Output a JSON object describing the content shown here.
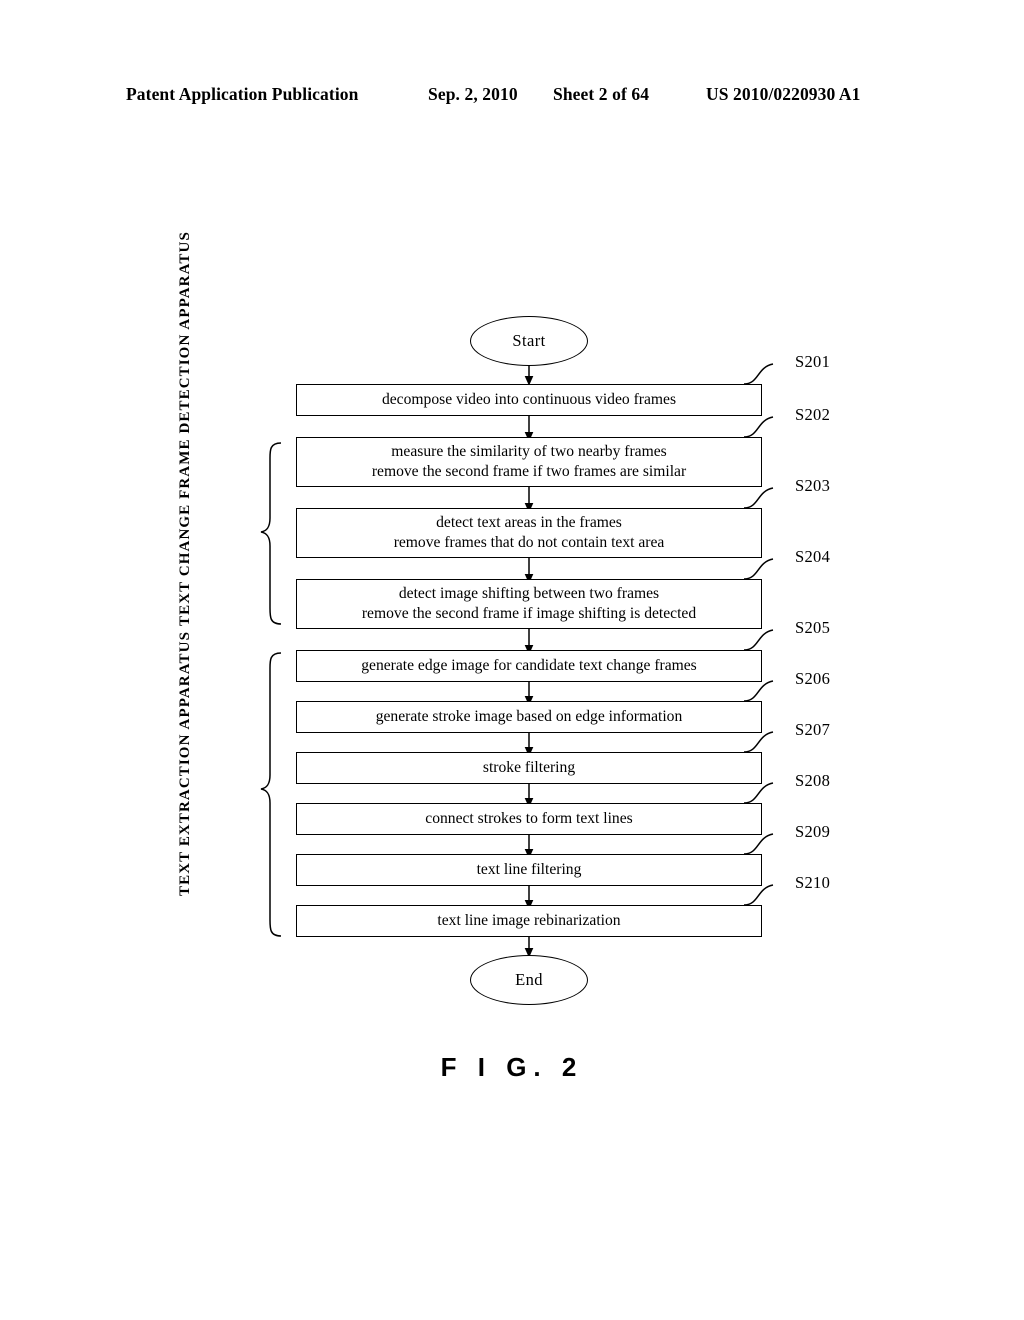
{
  "header": {
    "publication": "Patent Application Publication",
    "date": "Sep. 2, 2010",
    "sheet": "Sheet 2 of 64",
    "patent_number": "US 2010/0220930 A1"
  },
  "figure": {
    "caption": "F I G.  2"
  },
  "flowchart": {
    "start_label": "Start",
    "end_label": "End",
    "steps": [
      {
        "ref": "S201",
        "lines": [
          "decompose video into continuous video frames"
        ]
      },
      {
        "ref": "S202",
        "lines": [
          "measure the similarity of two nearby frames",
          "remove the second frame if two frames are similar"
        ]
      },
      {
        "ref": "S203",
        "lines": [
          "detect text areas in the frames",
          "remove frames that do not contain text area"
        ]
      },
      {
        "ref": "S204",
        "lines": [
          "detect image shifting between two frames",
          "remove the second frame if image shifting is detected"
        ]
      },
      {
        "ref": "S205",
        "lines": [
          "generate edge image for candidate text change frames"
        ]
      },
      {
        "ref": "S206",
        "lines": [
          "generate stroke image based on edge information"
        ]
      },
      {
        "ref": "S207",
        "lines": [
          "stroke filtering"
        ]
      },
      {
        "ref": "S208",
        "lines": [
          "connect strokes to form text lines"
        ]
      },
      {
        "ref": "S209",
        "lines": [
          "text line filtering"
        ]
      },
      {
        "ref": "S210",
        "lines": [
          "text line image rebinarization"
        ]
      }
    ],
    "groups": [
      {
        "label": "TEXT CHANGE FRAME\nDETECTION APPARATUS",
        "covers": [
          "S202",
          "S203",
          "S204"
        ]
      },
      {
        "label": "TEXT EXTRACTION\nAPPARATUS",
        "covers": [
          "S205",
          "S206",
          "S207",
          "S208",
          "S209",
          "S210"
        ]
      }
    ]
  },
  "colors": {
    "ink": "#000000",
    "paper": "#ffffff"
  }
}
